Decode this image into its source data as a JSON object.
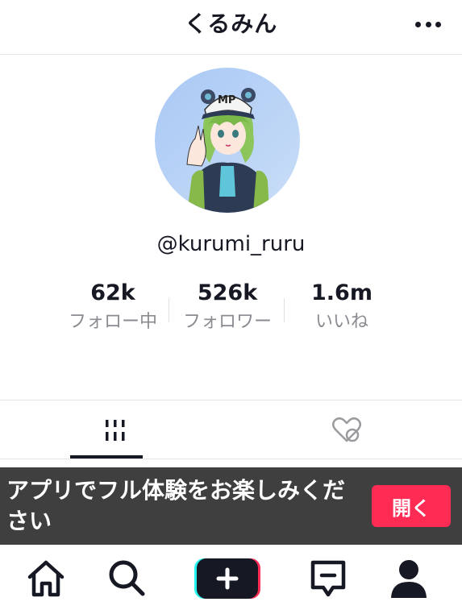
{
  "header": {
    "title": "くるみん"
  },
  "profile": {
    "avatar_icon": "avatar-illustration-icon",
    "username": "@kurumi_ruru",
    "stats": [
      {
        "value": "62k",
        "label": "フォロー中"
      },
      {
        "value": "526k",
        "label": "フォロワー"
      },
      {
        "value": "1.6m",
        "label": "いいね"
      }
    ]
  },
  "tabs": [
    {
      "icon": "videos-grid-icon",
      "active": true
    },
    {
      "icon": "liked-hidden-icon",
      "active": false
    }
  ],
  "banner": {
    "text": "アプリでフル体験をお楽しみください",
    "button_label": "開く"
  },
  "bottom_nav": [
    {
      "icon": "home-icon"
    },
    {
      "icon": "search-icon"
    },
    {
      "icon": "create-plus-icon"
    },
    {
      "icon": "inbox-icon"
    },
    {
      "icon": "profile-icon"
    }
  ],
  "colors": {
    "accent": "#fe2c55",
    "banner_bg": "#3f3f3f",
    "text": "#161823",
    "muted": "#8a8b91",
    "create_left": "#25f4ee",
    "create_right": "#fe2c55"
  }
}
